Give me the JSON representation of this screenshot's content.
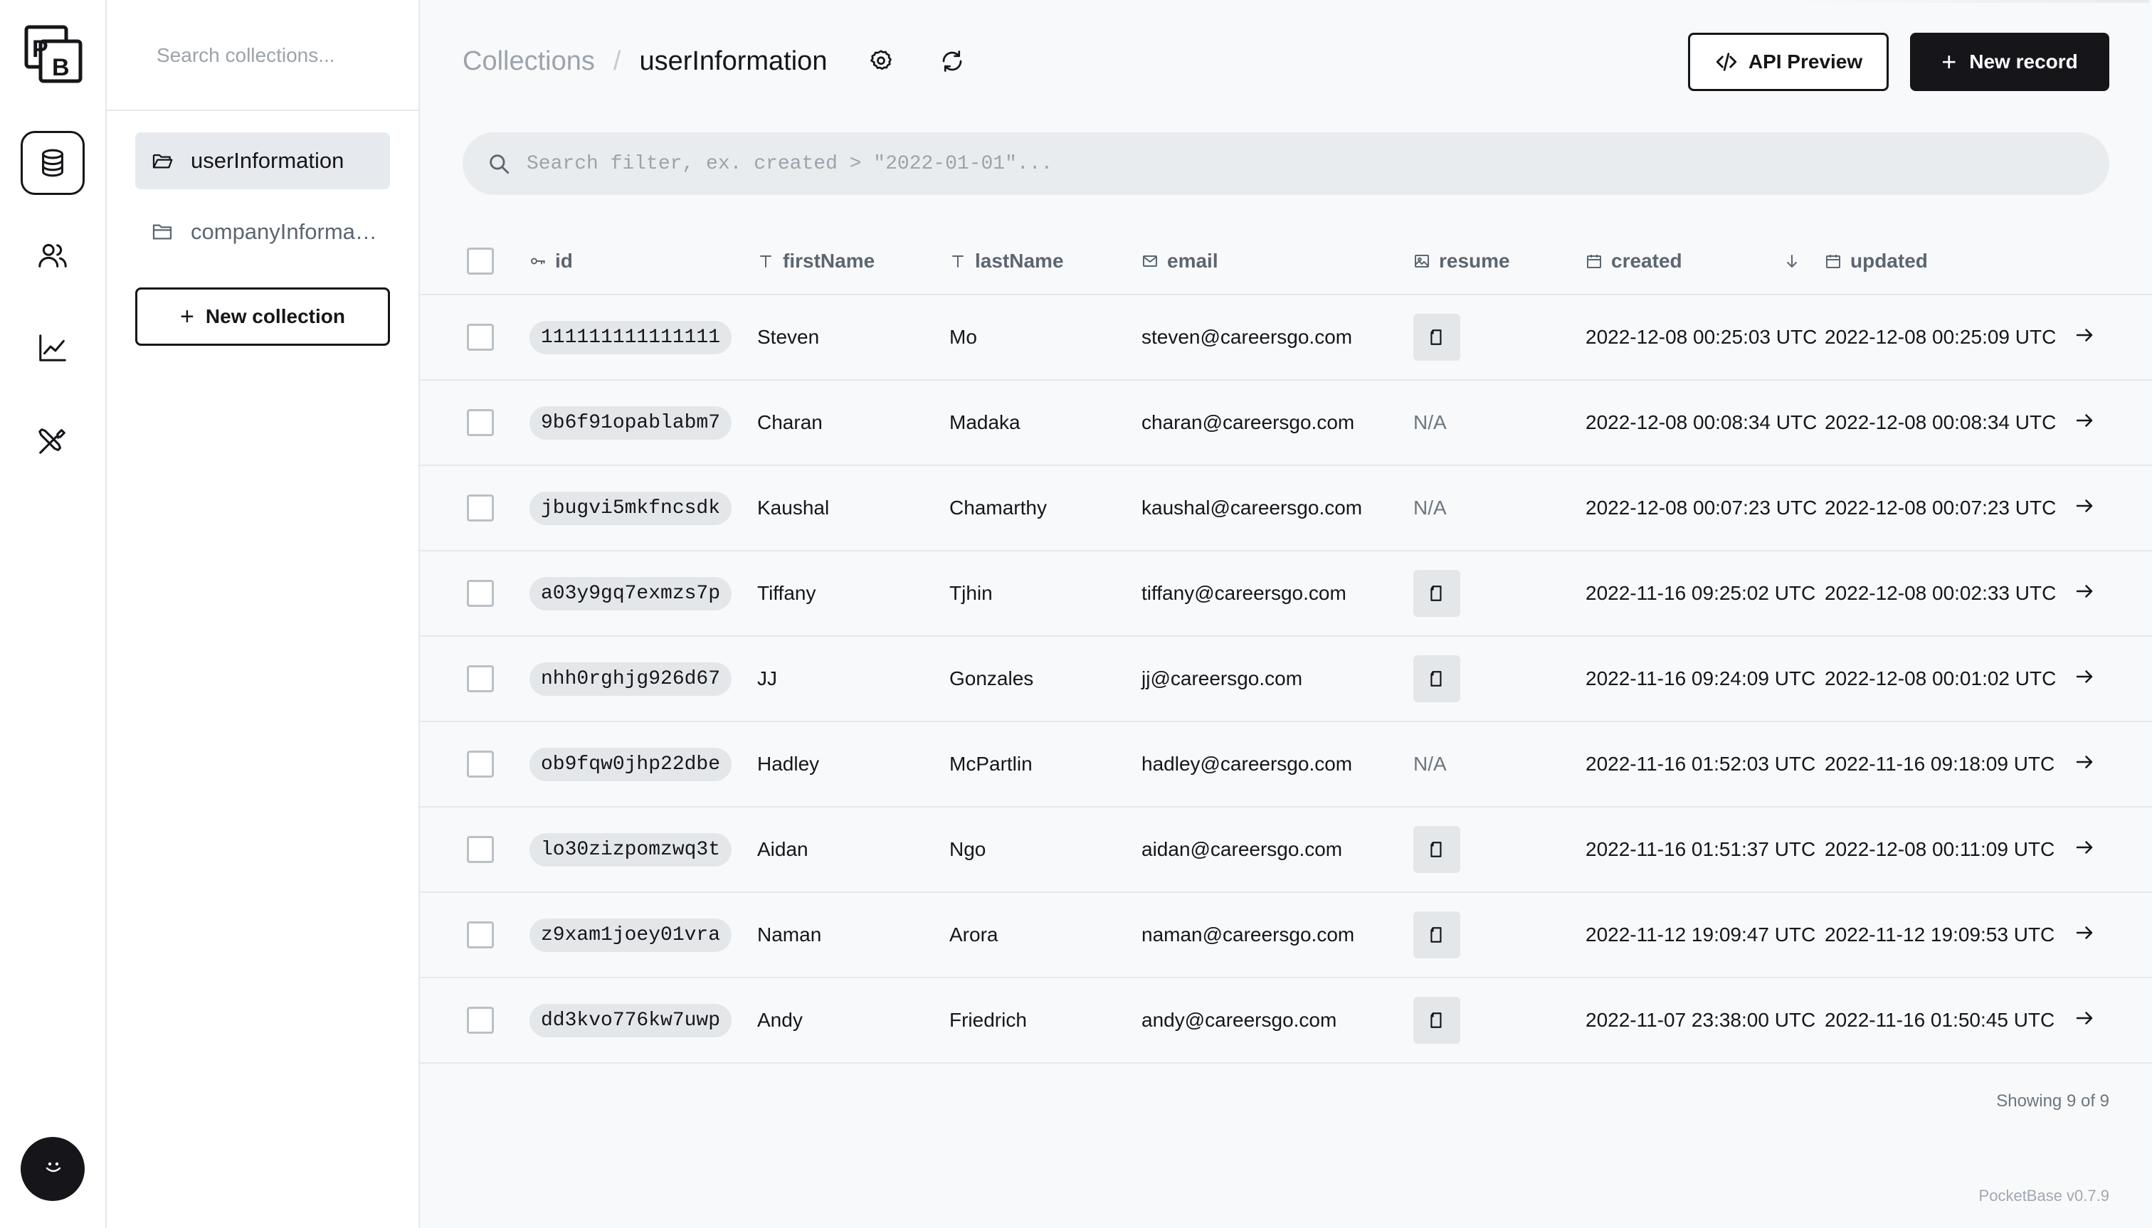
{
  "app": {
    "logo_letters": "PB",
    "version": "PocketBase v0.7.9"
  },
  "rail": {
    "items": [
      {
        "name": "collections",
        "icon": "database-icon",
        "active": true
      },
      {
        "name": "users",
        "icon": "users-icon",
        "active": false
      },
      {
        "name": "logs",
        "icon": "chart-line-icon",
        "active": false
      },
      {
        "name": "settings",
        "icon": "tools-icon",
        "active": false
      }
    ]
  },
  "sidebar": {
    "search_placeholder": "Search collections...",
    "collections": [
      {
        "label": "userInformation",
        "active": true
      },
      {
        "label": "companyInformation",
        "active": false
      }
    ],
    "new_collection_label": "New collection"
  },
  "header": {
    "breadcrumb_root": "Collections",
    "breadcrumb_separator": "/",
    "breadcrumb_current": "userInformation",
    "api_preview_label": "API Preview",
    "new_record_label": "New record"
  },
  "filter": {
    "placeholder": "Search filter, ex. created > \"2022-01-01\"..."
  },
  "table": {
    "columns": {
      "id": "id",
      "firstName": "firstName",
      "lastName": "lastName",
      "email": "email",
      "resume": "resume",
      "created": "created",
      "updated": "updated"
    },
    "rows": [
      {
        "id": "111111111111111",
        "firstName": "Steven",
        "lastName": "Mo",
        "email": "steven@careersgo.com",
        "resume": "file",
        "created": "2022-12-08 00:25:03 UTC",
        "updated": "2022-12-08 00:25:09 UTC"
      },
      {
        "id": "9b6f91opablabm7",
        "firstName": "Charan",
        "lastName": "Madaka",
        "email": "charan@careersgo.com",
        "resume": "N/A",
        "created": "2022-12-08 00:08:34 UTC",
        "updated": "2022-12-08 00:08:34 UTC"
      },
      {
        "id": "jbugvi5mkfncsdk",
        "firstName": "Kaushal",
        "lastName": "Chamarthy",
        "email": "kaushal@careersgo.com",
        "resume": "N/A",
        "created": "2022-12-08 00:07:23 UTC",
        "updated": "2022-12-08 00:07:23 UTC"
      },
      {
        "id": "a03y9gq7exmzs7p",
        "firstName": "Tiffany",
        "lastName": "Tjhin",
        "email": "tiffany@careersgo.com",
        "resume": "file",
        "created": "2022-11-16 09:25:02 UTC",
        "updated": "2022-12-08 00:02:33 UTC"
      },
      {
        "id": "nhh0rghjg926d67",
        "firstName": "JJ",
        "lastName": "Gonzales",
        "email": "jj@careersgo.com",
        "resume": "file",
        "created": "2022-11-16 09:24:09 UTC",
        "updated": "2022-12-08 00:01:02 UTC"
      },
      {
        "id": "ob9fqw0jhp22dbe",
        "firstName": "Hadley",
        "lastName": "McPartlin",
        "email": "hadley@careersgo.com",
        "resume": "N/A",
        "created": "2022-11-16 01:52:03 UTC",
        "updated": "2022-11-16 09:18:09 UTC"
      },
      {
        "id": "lo30zizpomzwq3t",
        "firstName": "Aidan",
        "lastName": "Ngo",
        "email": "aidan@careersgo.com",
        "resume": "file",
        "created": "2022-11-16 01:51:37 UTC",
        "updated": "2022-12-08 00:11:09 UTC"
      },
      {
        "id": "z9xam1joey01vra",
        "firstName": "Naman",
        "lastName": "Arora",
        "email": "naman@careersgo.com",
        "resume": "file",
        "created": "2022-11-12 19:09:47 UTC",
        "updated": "2022-11-12 19:09:53 UTC"
      },
      {
        "id": "dd3kvo776kw7uwp",
        "firstName": "Andy",
        "lastName": "Friedrich",
        "email": "andy@careersgo.com",
        "resume": "file",
        "created": "2022-11-07 23:38:00 UTC",
        "updated": "2022-11-16 01:50:45 UTC"
      }
    ],
    "sort": {
      "column": "created",
      "direction": "desc"
    },
    "footer_count": "Showing 9 of 9"
  },
  "colors": {
    "accent": "#16161a",
    "background": "#f8f9fa",
    "border": "#e4e9ec",
    "muted_text": "#5c6670"
  }
}
